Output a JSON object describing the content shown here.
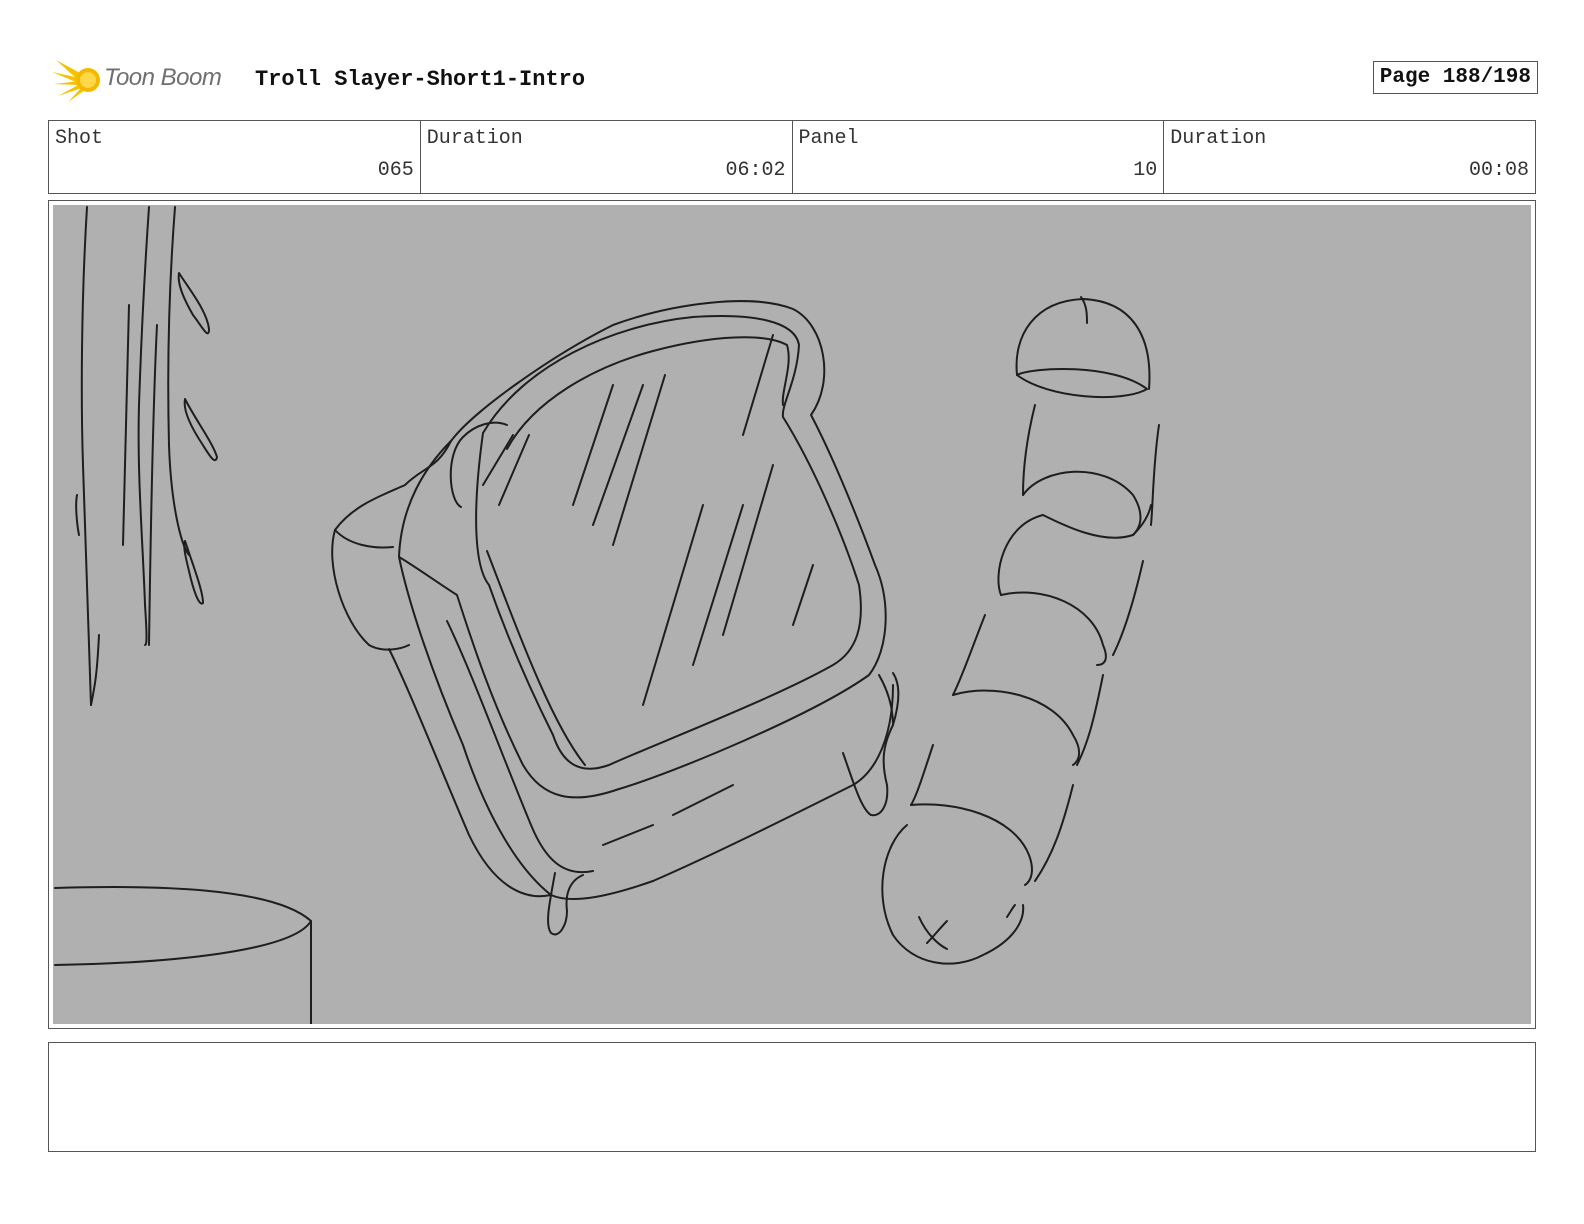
{
  "header": {
    "logo_text": "Toon Boom",
    "project_title": "Troll Slayer-Short1-Intro",
    "page_label": "Page 188/198"
  },
  "info": {
    "shot_label": "Shot",
    "shot_value": "065",
    "shot_duration_label": "Duration",
    "shot_duration_value": "06:02",
    "panel_label": "Panel",
    "panel_value": "10",
    "panel_duration_label": "Duration",
    "panel_duration_value": "00:08"
  },
  "colors": {
    "panel_background": "#b0b0b0",
    "sketch_line": "#1e1e1e",
    "logo_yellow": "#f5c400"
  },
  "notes": {
    "text": ""
  }
}
